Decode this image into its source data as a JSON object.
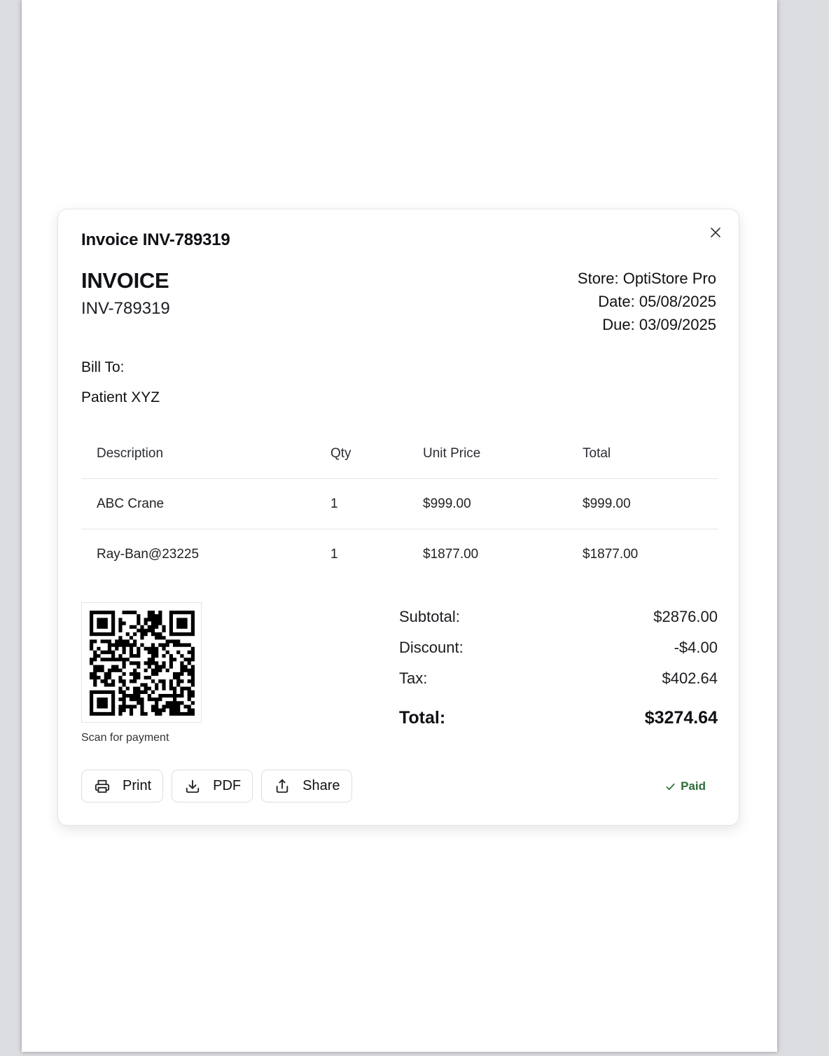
{
  "dialog": {
    "title": "Invoice INV-789319",
    "close_icon": "close-icon"
  },
  "invoice": {
    "heading": "INVOICE",
    "number": "INV-789319",
    "store": "Store: OptiStore Pro",
    "date": "Date: 05/08/2025",
    "due": "Due: 03/09/2025"
  },
  "bill_to": {
    "label": "Bill To:",
    "name": "Patient XYZ"
  },
  "table": {
    "headers": [
      "Description",
      "Qty",
      "Unit Price",
      "Total"
    ],
    "rows": [
      [
        "ABC Crane",
        "1",
        "$999.00",
        "$999.00"
      ],
      [
        "Ray-Ban@23225",
        "1",
        "$1877.00",
        "$1877.00"
      ]
    ]
  },
  "qr": {
    "icon": "qr-code",
    "caption": "Scan for payment"
  },
  "totals": {
    "subtotal_label": "Subtotal:",
    "subtotal": "$2876.00",
    "discount_label": "Discount:",
    "discount": "-$4.00",
    "tax_label": "Tax:",
    "tax": "$402.64",
    "total_label": "Total:",
    "total": "$3274.64"
  },
  "actions": {
    "print": "Print",
    "pdf": "PDF",
    "share": "Share"
  },
  "status": {
    "label": "Paid",
    "color": "#2f6e3a"
  }
}
